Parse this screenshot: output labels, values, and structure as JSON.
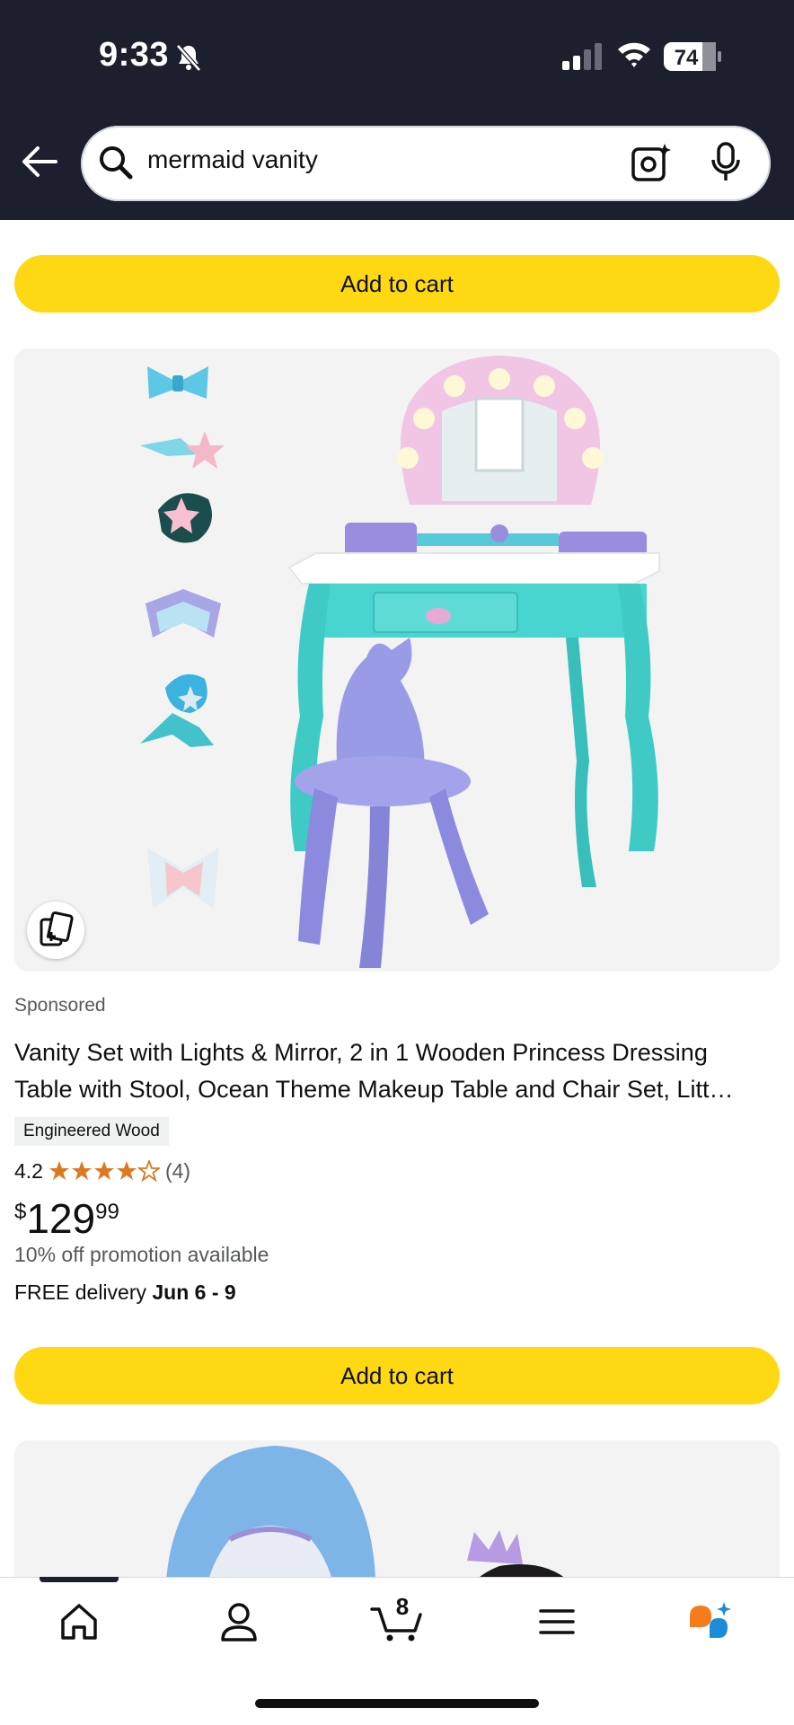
{
  "status_bar": {
    "time": "9:33",
    "battery": "74",
    "icons": [
      "bell-slash-icon",
      "signal-icon",
      "wifi-icon",
      "battery-icon"
    ]
  },
  "header": {
    "back_icon": "arrow-left-icon",
    "search_query": "mermaid vanity",
    "icons": [
      "search-icon",
      "camera-lens-icon",
      "microphone-icon"
    ]
  },
  "top_cart_button": {
    "label": "Add to cart"
  },
  "product": {
    "sponsored": "Sponsored",
    "title_line1": "Vanity Set with Lights & Mirror, 2 in 1 Wooden Princess Dressing",
    "title_line2": "Table with Stool, Ocean Theme Makeup Table and Chair Set, Litt…",
    "badge": "Engineered Wood",
    "rating": "4.2",
    "rating_value": 4.2,
    "review_count": "(4)",
    "price_currency": "$",
    "price_whole": "129",
    "price_fraction": "99",
    "promotion": "10% off promotion available",
    "delivery_prefix": "FREE delivery ",
    "delivery_dates": "Jun 6 - 9",
    "cart_label": "Add to cart"
  },
  "bottom_nav": {
    "cart_count": "8",
    "items": [
      "home-icon",
      "account-icon",
      "cart-icon",
      "menu-icon",
      "rufus-assistant-icon"
    ]
  },
  "colors": {
    "header_bg": "#1b1f2e",
    "button_yellow": "#ffd814",
    "star_orange": "#de7921"
  }
}
